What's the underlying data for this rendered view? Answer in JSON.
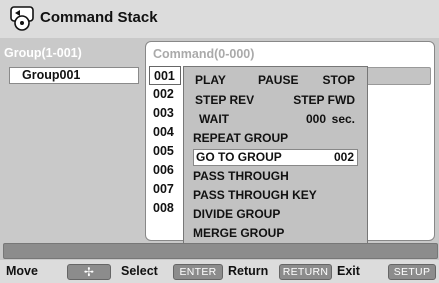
{
  "window": {
    "title": "Command Stack"
  },
  "group_panel": {
    "header": "Group(1-001)",
    "items": [
      {
        "label": "Group001"
      }
    ]
  },
  "command_panel": {
    "header": "Command(0-000)",
    "numbers": [
      "001",
      "002",
      "003",
      "004",
      "005",
      "006",
      "007",
      "008"
    ],
    "selected_number": "001"
  },
  "popup_menu": {
    "play_row": {
      "play": "PLAY",
      "pause": "PAUSE",
      "stop": "STOP"
    },
    "step_row": {
      "rev": "STEP REV",
      "fwd": "STEP FWD"
    },
    "wait_row": {
      "label": "WAIT",
      "value": "000",
      "unit": "sec."
    },
    "repeat_group": "REPEAT GROUP",
    "go_to_group": {
      "label": "GO TO GROUP",
      "value": "002"
    },
    "pass_through": "PASS THROUGH",
    "pass_through_key": "PASS THROUGH KEY",
    "divide_group": "DIVIDE  GROUP",
    "merge_group": "MERGE  GROUP"
  },
  "nav": {
    "move": "Move",
    "move_key": "✢",
    "select": "Select",
    "select_key": "ENTER",
    "return": "Return",
    "return_key": "RETURN",
    "exit": "Exit",
    "exit_key": "SETUP"
  }
}
